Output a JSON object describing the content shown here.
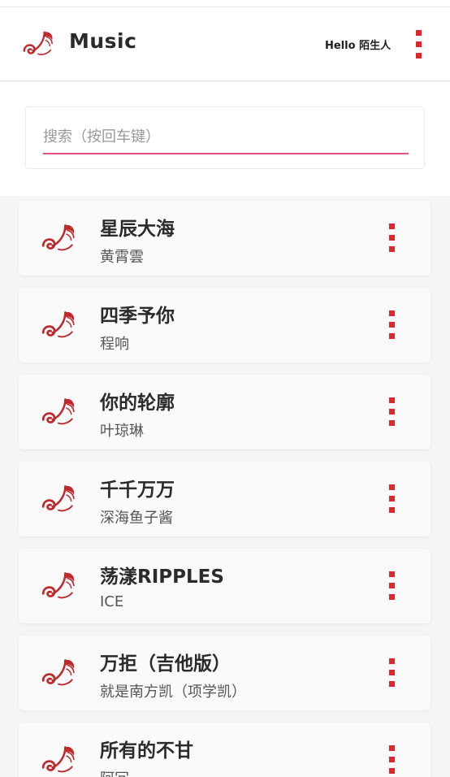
{
  "app": {
    "title": "Music",
    "greeting": "Hello 陌生人",
    "brand_color": "#c0292b",
    "menu_icon": "more-vertical-icon"
  },
  "search": {
    "placeholder": "搜索（按回车键）",
    "value": "",
    "underline_color": "#e2547c"
  },
  "songs": [
    {
      "title": "星辰大海",
      "artist": "黄霄雲"
    },
    {
      "title": "四季予你",
      "artist": "程响"
    },
    {
      "title": "你的轮廓",
      "artist": "叶琼琳"
    },
    {
      "title": "千千万万",
      "artist": "深海鱼子酱"
    },
    {
      "title": "荡漾RIPPLES",
      "artist": "ICE"
    },
    {
      "title": "万拒（吉他版）",
      "artist": "就是南方凯（项学凯）"
    },
    {
      "title": "所有的不甘",
      "artist": "阿冗"
    }
  ]
}
